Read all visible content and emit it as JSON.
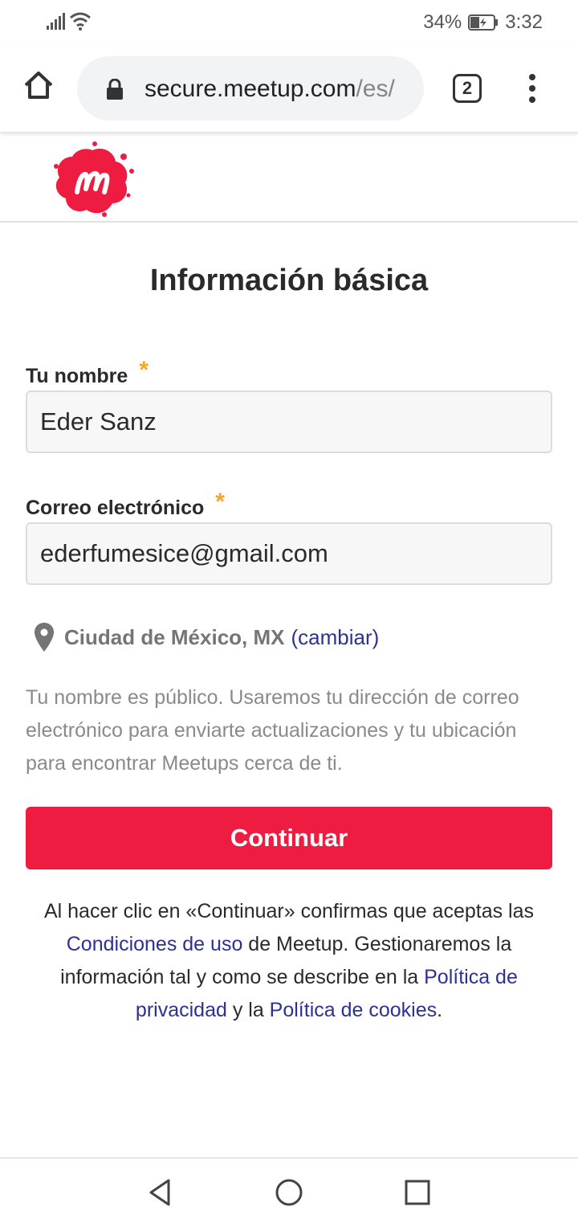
{
  "status_bar": {
    "battery": "34%",
    "time": "3:32"
  },
  "browser": {
    "url_domain": "secure.meetup.com",
    "url_path": "/es/",
    "tab_count": "2"
  },
  "page": {
    "title": "Información básica",
    "name_field": {
      "label": "Tu nombre",
      "required": "*",
      "value": "Eder Sanz"
    },
    "email_field": {
      "label": "Correo electrónico",
      "required": "*",
      "value": "ederfumesice@gmail.com"
    },
    "location": {
      "text": "Ciudad de México, MX",
      "change": "(cambiar)"
    },
    "info": "Tu nombre es público. Usaremos tu dirección de correo electrónico para enviarte actualizaciones y tu ubicación para encontrar Meetups cerca de ti.",
    "continue_label": "Continuar",
    "legal": {
      "part1": "Al hacer clic en «Continuar» confirmas que aceptas las ",
      "terms_link": "Condiciones de uso",
      "part2": " de Meetup. Gestionaremos la información tal y como se describe en la ",
      "privacy_link": "Política de privacidad",
      "part3": " y la ",
      "cookies_link": "Política de cookies",
      "part4": "."
    }
  },
  "colors": {
    "brand_red": "#ed1c40",
    "link_blue": "#2e3192",
    "required_orange": "#f5a623"
  },
  "icons": [
    "signal-icon",
    "wifi-icon",
    "battery-icon",
    "home-icon",
    "lock-icon",
    "menu-icon",
    "meetup-logo",
    "location-pin-icon",
    "back-icon",
    "home-circle-icon",
    "recents-icon"
  ]
}
